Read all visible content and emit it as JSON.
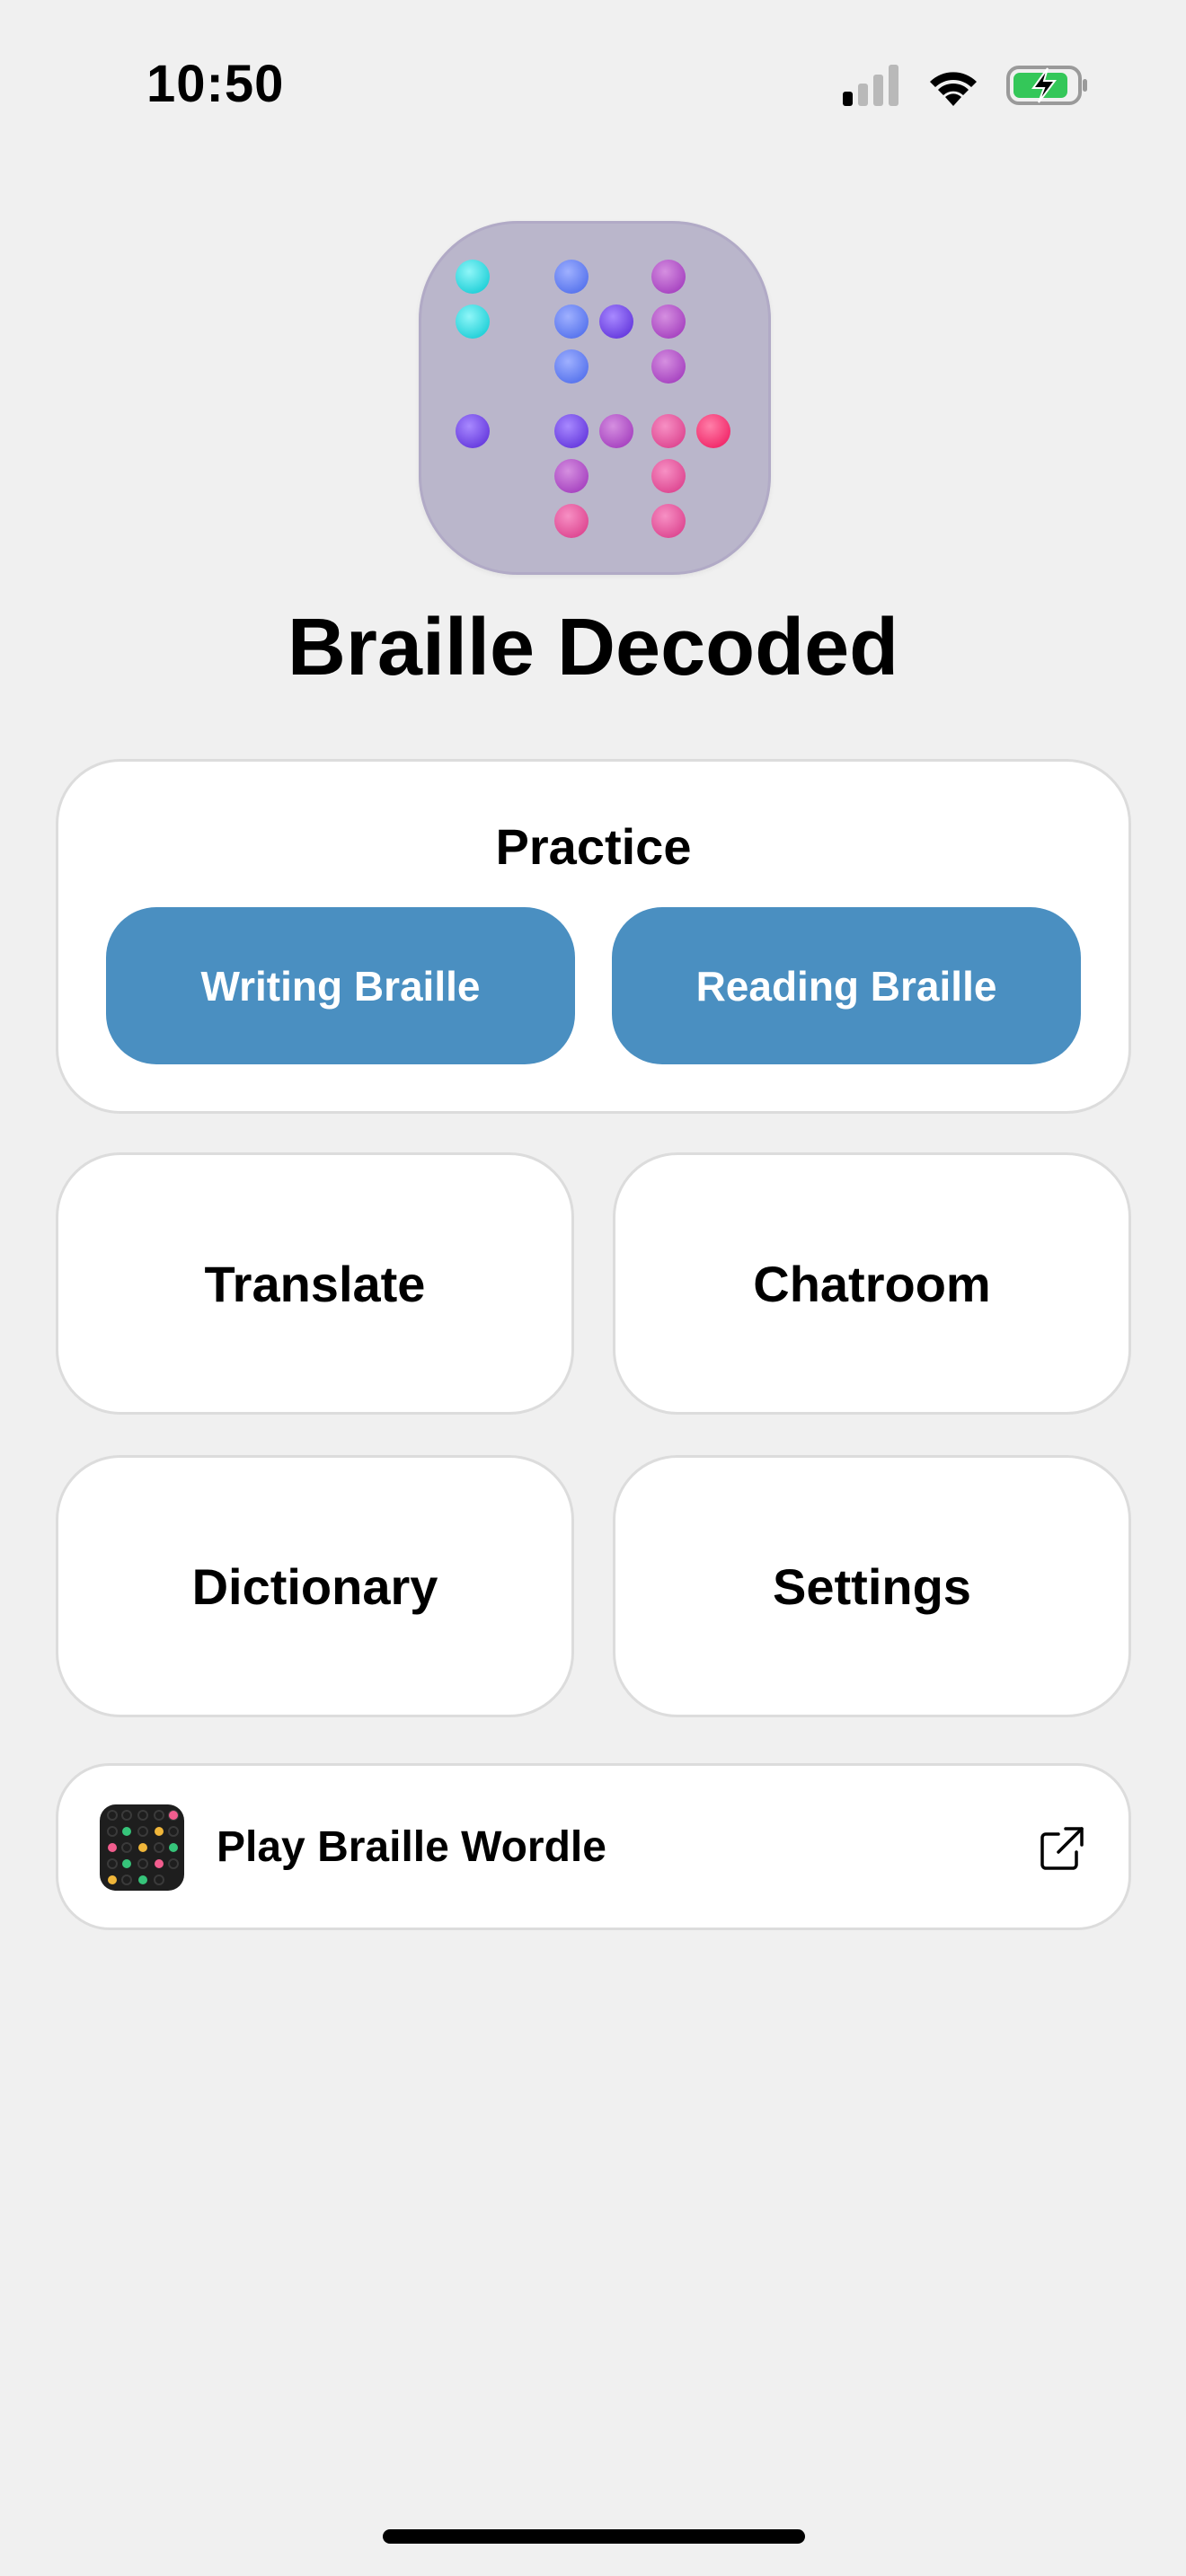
{
  "status_bar": {
    "time": "10:50",
    "signal_icon": "cellular-signal-icon",
    "wifi_icon": "wifi-icon",
    "battery_icon": "battery-charging-icon"
  },
  "header": {
    "app_icon": "braille-app-icon",
    "title": "Braille Decoded"
  },
  "practice": {
    "title": "Practice",
    "writing_label": "Writing Braille",
    "reading_label": "Reading Braille"
  },
  "tiles": {
    "translate": "Translate",
    "chatroom": "Chatroom",
    "dictionary": "Dictionary",
    "settings": "Settings"
  },
  "wordle": {
    "label": "Play Braille Wordle",
    "thumb_icon": "braille-wordle-icon",
    "link_icon": "external-link-icon"
  },
  "colors": {
    "background": "#f0f0f0",
    "card": "#ffffff",
    "accent_button": "#4a8fc1",
    "app_icon_bg": "#bab6cb"
  }
}
